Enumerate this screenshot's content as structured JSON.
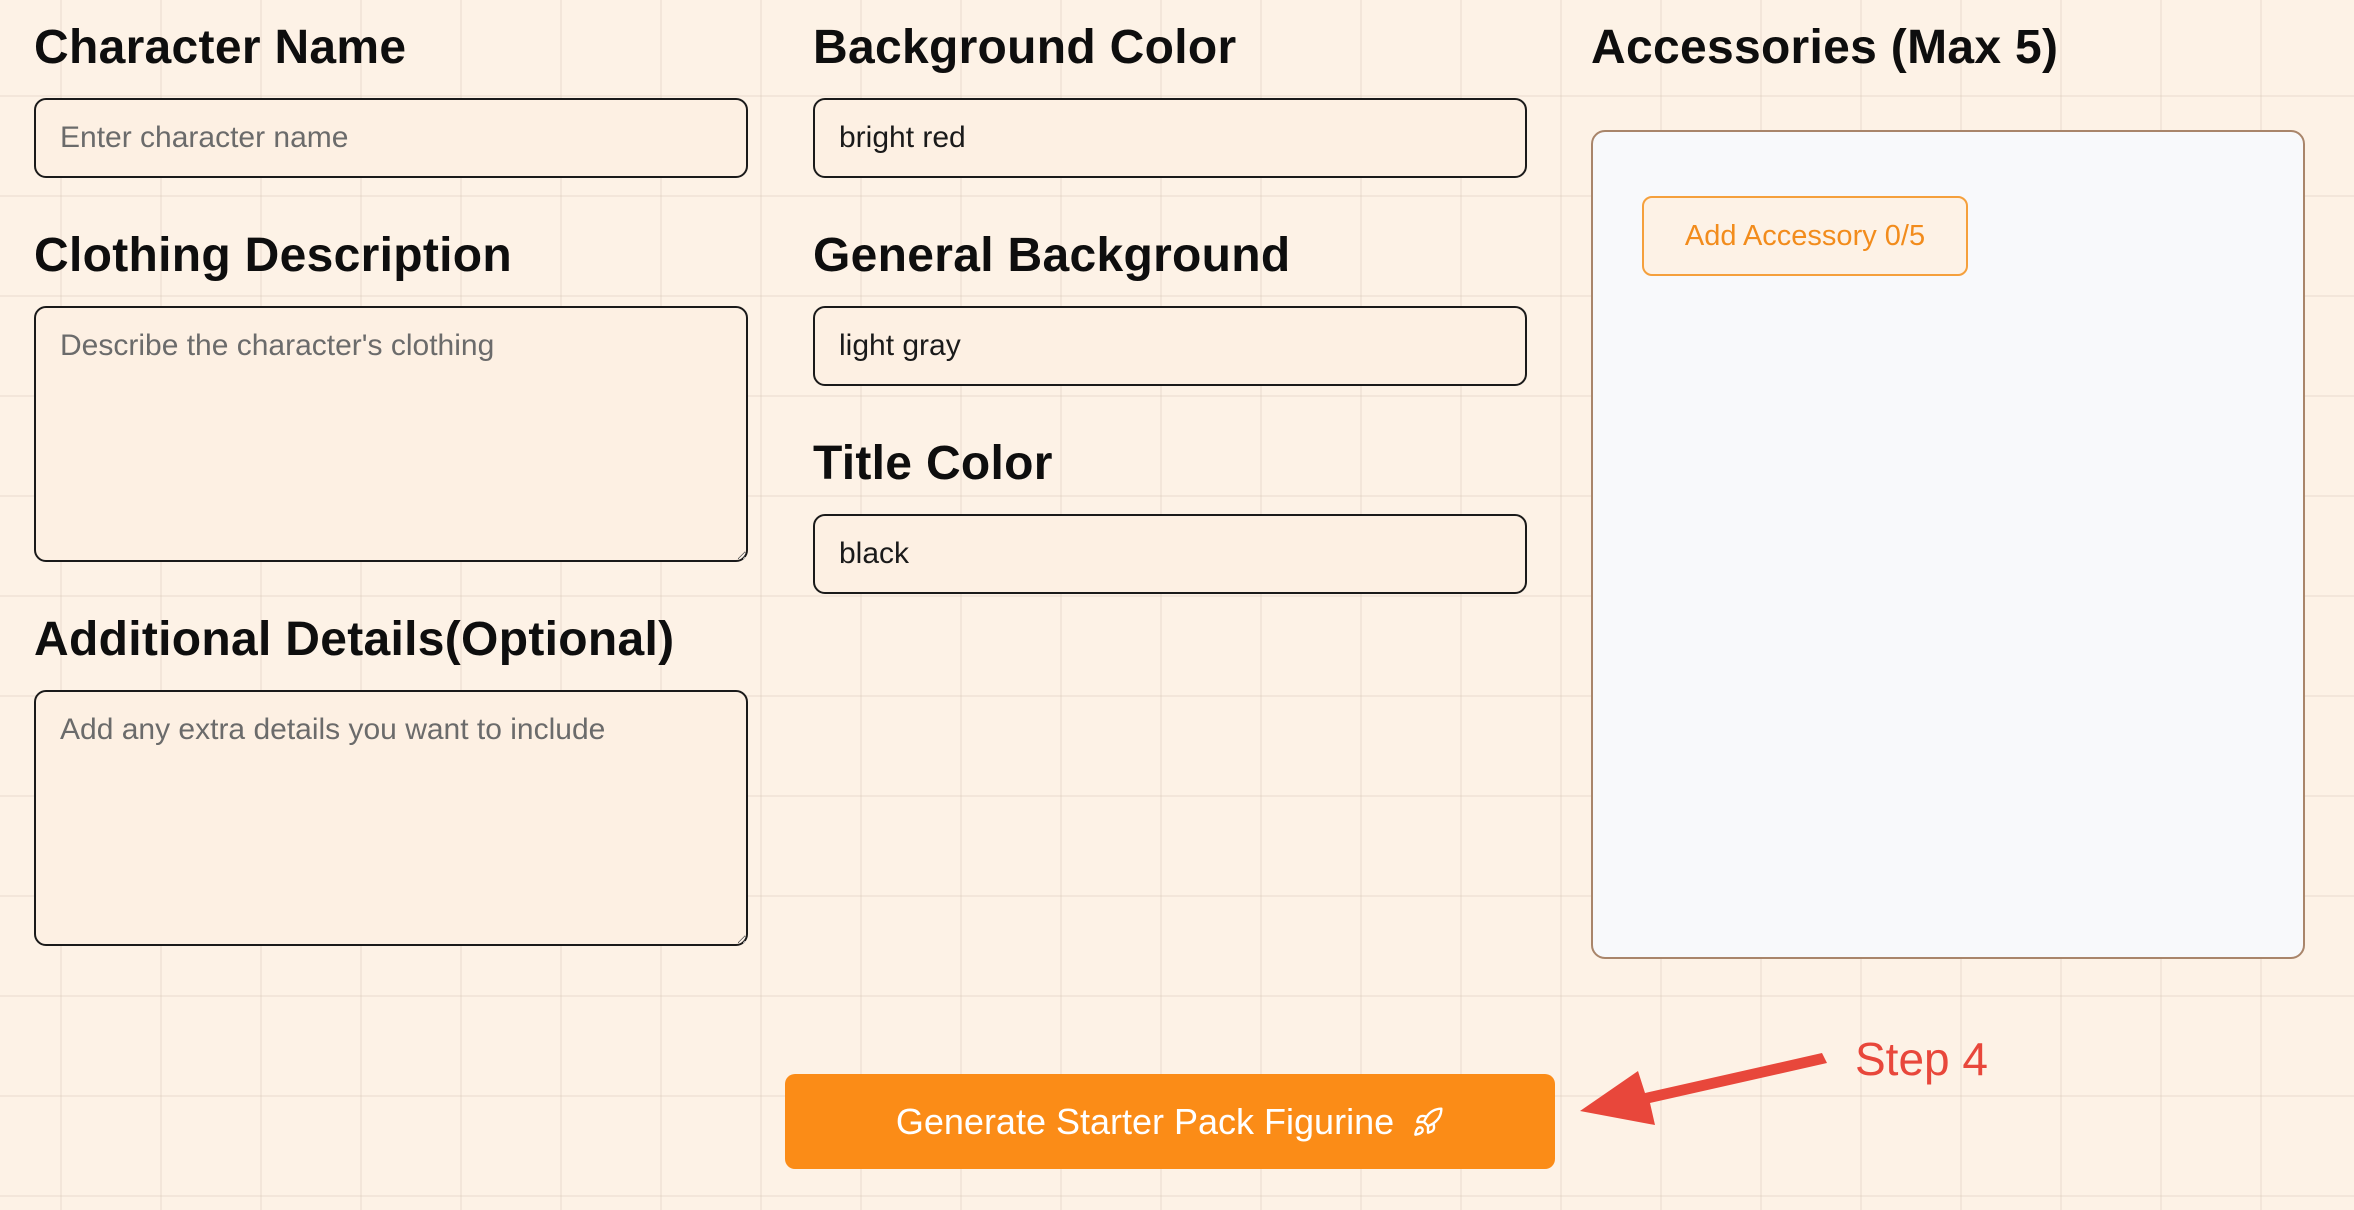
{
  "form": {
    "character_name": {
      "label": "Character Name",
      "value": "",
      "placeholder": "Enter character name"
    },
    "clothing_description": {
      "label": "Clothing Description",
      "value": "",
      "placeholder": "Describe the character's clothing"
    },
    "additional_details": {
      "label": "Additional Details(Optional)",
      "value": "",
      "placeholder": "Add any extra details you want to include"
    },
    "background_color": {
      "label": "Background Color",
      "value": "bright red",
      "placeholder": ""
    },
    "general_background": {
      "label": "General Background",
      "value": "light gray",
      "placeholder": ""
    },
    "title_color": {
      "label": "Title Color",
      "value": "black",
      "placeholder": ""
    }
  },
  "accessories": {
    "label": "Accessories (Max 5)",
    "add_button_label": "Add Accessory 0/5",
    "count": 0,
    "max": 5
  },
  "generate_button": {
    "label": "Generate Starter Pack Figurine",
    "icon": "rocket-icon"
  },
  "annotation": {
    "step_label": "Step 4",
    "color": "#e8473b"
  },
  "colors": {
    "accent": "#fb8c17",
    "page_background": "#fdf2e6",
    "panel_background": "#f8f9fb"
  }
}
